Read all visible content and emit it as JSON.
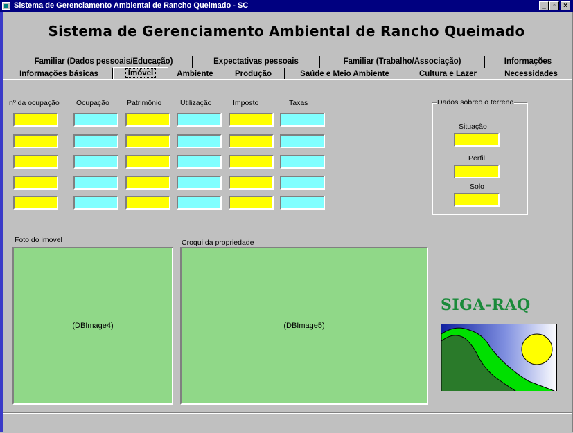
{
  "window": {
    "title": "Sistema de Gerenciamento Ambiental de Rancho Queimado - SC",
    "minimize_glyph": "_",
    "maximize_glyph": "▫",
    "close_glyph": "×"
  },
  "app_title": "Sistema de Gerenciamento Ambiental de Rancho Queimado",
  "tabs_row1": [
    {
      "label": "Familiar (Dados pessoais/Educação)"
    },
    {
      "label": "Expectativas pessoais"
    },
    {
      "label": "Familiar (Trabalho/Associação)"
    },
    {
      "label": "Informações"
    }
  ],
  "tabs_row2": [
    {
      "label": "Informações básicas"
    },
    {
      "label": "Imóvel",
      "active": true
    },
    {
      "label": "Ambiente"
    },
    {
      "label": "Produção"
    },
    {
      "label": "Saúde e Meio Ambiente"
    },
    {
      "label": "Cultura e Lazer"
    },
    {
      "label": "Necessidades"
    }
  ],
  "columns": [
    "nº da ocupação",
    "Ocupação",
    "Patrimônio",
    "Utilização",
    "Imposto",
    "Taxas"
  ],
  "row_count": 5,
  "colors": {
    "yellow_field": "#ffff00",
    "cyan_field": "#80ffff",
    "image_bg": "#90d888",
    "brand": "#1a8a3a",
    "titlebar": "#000080"
  },
  "terrain": {
    "group_label": "Dados sobreo o terreno",
    "fields": [
      "Situação",
      "Perfil",
      "Solo"
    ]
  },
  "photo": {
    "label": "Foto do imovel",
    "placeholder": "(DBImage4)"
  },
  "sketch": {
    "label": "Croqui da propriedade",
    "placeholder": "(DBImage5)"
  },
  "brand": {
    "name": "SIGA-RAQ",
    "logo": "landscape-sun-logo"
  }
}
